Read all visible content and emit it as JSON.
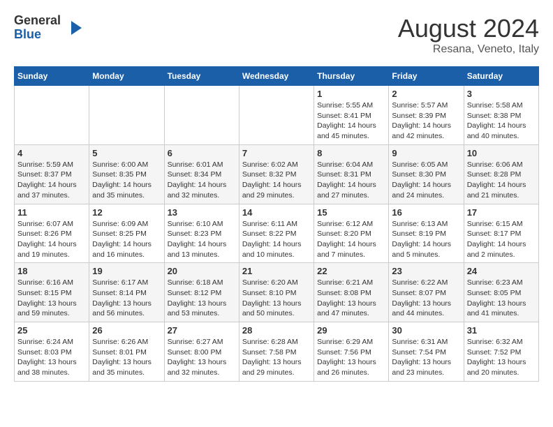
{
  "logo": {
    "general": "General",
    "blue": "Blue"
  },
  "title": "August 2024",
  "location": "Resana, Veneto, Italy",
  "days_of_week": [
    "Sunday",
    "Monday",
    "Tuesday",
    "Wednesday",
    "Thursday",
    "Friday",
    "Saturday"
  ],
  "weeks": [
    [
      {
        "day": "",
        "info": ""
      },
      {
        "day": "",
        "info": ""
      },
      {
        "day": "",
        "info": ""
      },
      {
        "day": "",
        "info": ""
      },
      {
        "day": "1",
        "info": "Sunrise: 5:55 AM\nSunset: 8:41 PM\nDaylight: 14 hours and 45 minutes."
      },
      {
        "day": "2",
        "info": "Sunrise: 5:57 AM\nSunset: 8:39 PM\nDaylight: 14 hours and 42 minutes."
      },
      {
        "day": "3",
        "info": "Sunrise: 5:58 AM\nSunset: 8:38 PM\nDaylight: 14 hours and 40 minutes."
      }
    ],
    [
      {
        "day": "4",
        "info": "Sunrise: 5:59 AM\nSunset: 8:37 PM\nDaylight: 14 hours and 37 minutes."
      },
      {
        "day": "5",
        "info": "Sunrise: 6:00 AM\nSunset: 8:35 PM\nDaylight: 14 hours and 35 minutes."
      },
      {
        "day": "6",
        "info": "Sunrise: 6:01 AM\nSunset: 8:34 PM\nDaylight: 14 hours and 32 minutes."
      },
      {
        "day": "7",
        "info": "Sunrise: 6:02 AM\nSunset: 8:32 PM\nDaylight: 14 hours and 29 minutes."
      },
      {
        "day": "8",
        "info": "Sunrise: 6:04 AM\nSunset: 8:31 PM\nDaylight: 14 hours and 27 minutes."
      },
      {
        "day": "9",
        "info": "Sunrise: 6:05 AM\nSunset: 8:30 PM\nDaylight: 14 hours and 24 minutes."
      },
      {
        "day": "10",
        "info": "Sunrise: 6:06 AM\nSunset: 8:28 PM\nDaylight: 14 hours and 21 minutes."
      }
    ],
    [
      {
        "day": "11",
        "info": "Sunrise: 6:07 AM\nSunset: 8:26 PM\nDaylight: 14 hours and 19 minutes."
      },
      {
        "day": "12",
        "info": "Sunrise: 6:09 AM\nSunset: 8:25 PM\nDaylight: 14 hours and 16 minutes."
      },
      {
        "day": "13",
        "info": "Sunrise: 6:10 AM\nSunset: 8:23 PM\nDaylight: 14 hours and 13 minutes."
      },
      {
        "day": "14",
        "info": "Sunrise: 6:11 AM\nSunset: 8:22 PM\nDaylight: 14 hours and 10 minutes."
      },
      {
        "day": "15",
        "info": "Sunrise: 6:12 AM\nSunset: 8:20 PM\nDaylight: 14 hours and 7 minutes."
      },
      {
        "day": "16",
        "info": "Sunrise: 6:13 AM\nSunset: 8:19 PM\nDaylight: 14 hours and 5 minutes."
      },
      {
        "day": "17",
        "info": "Sunrise: 6:15 AM\nSunset: 8:17 PM\nDaylight: 14 hours and 2 minutes."
      }
    ],
    [
      {
        "day": "18",
        "info": "Sunrise: 6:16 AM\nSunset: 8:15 PM\nDaylight: 13 hours and 59 minutes."
      },
      {
        "day": "19",
        "info": "Sunrise: 6:17 AM\nSunset: 8:14 PM\nDaylight: 13 hours and 56 minutes."
      },
      {
        "day": "20",
        "info": "Sunrise: 6:18 AM\nSunset: 8:12 PM\nDaylight: 13 hours and 53 minutes."
      },
      {
        "day": "21",
        "info": "Sunrise: 6:20 AM\nSunset: 8:10 PM\nDaylight: 13 hours and 50 minutes."
      },
      {
        "day": "22",
        "info": "Sunrise: 6:21 AM\nSunset: 8:08 PM\nDaylight: 13 hours and 47 minutes."
      },
      {
        "day": "23",
        "info": "Sunrise: 6:22 AM\nSunset: 8:07 PM\nDaylight: 13 hours and 44 minutes."
      },
      {
        "day": "24",
        "info": "Sunrise: 6:23 AM\nSunset: 8:05 PM\nDaylight: 13 hours and 41 minutes."
      }
    ],
    [
      {
        "day": "25",
        "info": "Sunrise: 6:24 AM\nSunset: 8:03 PM\nDaylight: 13 hours and 38 minutes."
      },
      {
        "day": "26",
        "info": "Sunrise: 6:26 AM\nSunset: 8:01 PM\nDaylight: 13 hours and 35 minutes."
      },
      {
        "day": "27",
        "info": "Sunrise: 6:27 AM\nSunset: 8:00 PM\nDaylight: 13 hours and 32 minutes."
      },
      {
        "day": "28",
        "info": "Sunrise: 6:28 AM\nSunset: 7:58 PM\nDaylight: 13 hours and 29 minutes."
      },
      {
        "day": "29",
        "info": "Sunrise: 6:29 AM\nSunset: 7:56 PM\nDaylight: 13 hours and 26 minutes."
      },
      {
        "day": "30",
        "info": "Sunrise: 6:31 AM\nSunset: 7:54 PM\nDaylight: 13 hours and 23 minutes."
      },
      {
        "day": "31",
        "info": "Sunrise: 6:32 AM\nSunset: 7:52 PM\nDaylight: 13 hours and 20 minutes."
      }
    ]
  ]
}
